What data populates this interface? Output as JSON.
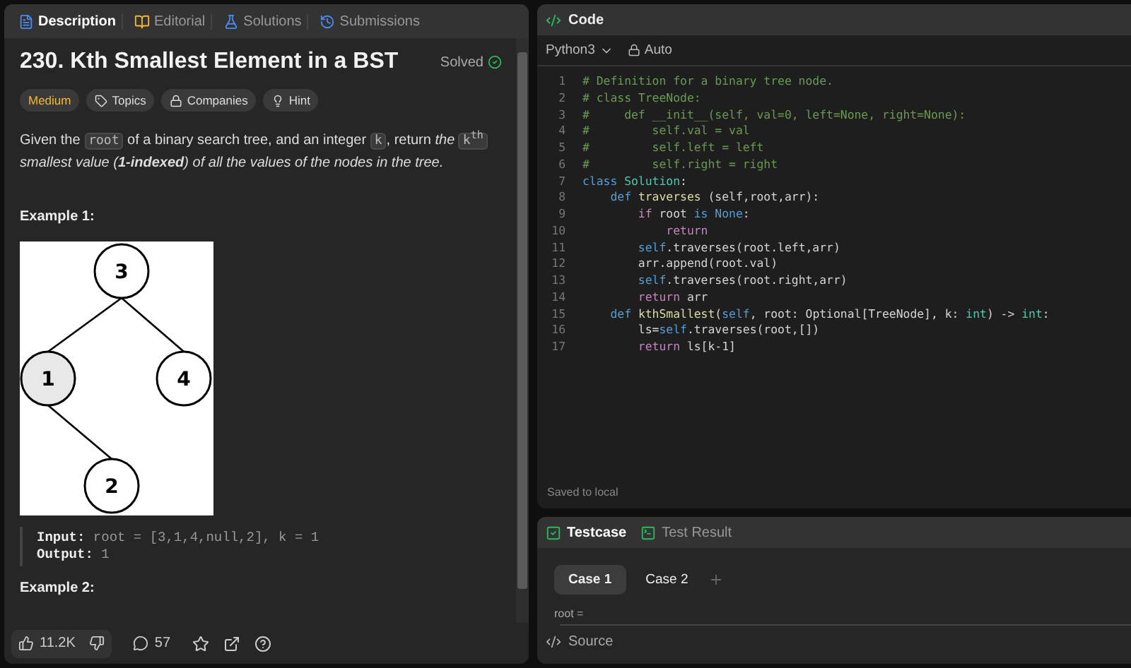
{
  "left_tabs": [
    {
      "label": "Description",
      "selected": true
    },
    {
      "label": "Editorial",
      "selected": false
    },
    {
      "label": "Solutions",
      "selected": false
    },
    {
      "label": "Submissions",
      "selected": false
    }
  ],
  "problem": {
    "title": "230. Kth Smallest Element in a BST",
    "status": "Solved",
    "tags": [
      {
        "label": "Medium",
        "kind": "difficulty"
      },
      {
        "label": "Topics",
        "kind": "topics"
      },
      {
        "label": "Companies",
        "kind": "companies"
      },
      {
        "label": "Hint",
        "kind": "hint"
      }
    ],
    "description": [
      {
        "kind": "plain",
        "text": "Given the "
      },
      {
        "kind": "code",
        "text": "root"
      },
      {
        "kind": "plain",
        "text": " of a binary search tree, and an integer "
      },
      {
        "kind": "code",
        "text": "k"
      },
      {
        "kind": "plain",
        "text": ", return "
      },
      {
        "kind": "italic",
        "text": "the "
      },
      {
        "kind": "code",
        "text": "k$^{th}$"
      },
      {
        "kind": "italic",
        "text": " smallest value (**1-indexed**) of all the values of the nodes in the tree."
      }
    ],
    "examples": [
      {
        "heading": "Example 1:",
        "tree": [
          {
            "value": "3",
            "highlighted": false
          },
          {
            "value": "1",
            "highlighted": true
          },
          {
            "value": "4",
            "highlighted": false
          },
          {
            "value": "2",
            "highlighted": false
          }
        ],
        "lines": [
          {
            "label": "Input:",
            "value": "root = [3,1,4,null,2], k = 1"
          },
          {
            "label": "Output:",
            "value": "1"
          }
        ]
      },
      {
        "heading": "Example 2:"
      }
    ]
  },
  "footer": {
    "likes": "11.2K",
    "comments": "57"
  },
  "code_panel": {
    "title": "Code",
    "language": "Python3",
    "mode": "Auto",
    "status": "Saved to local",
    "lines": [
      {
        "number": "1",
        "tokens": [
          {
            "kind": "comment",
            "text": "# Definition for a binary tree node."
          }
        ]
      },
      {
        "number": "2",
        "tokens": [
          {
            "kind": "comment",
            "text": "# class TreeNode:"
          }
        ]
      },
      {
        "number": "3",
        "tokens": [
          {
            "kind": "comment",
            "text": "#     def __init__(self, val=0, left=None, right=None):"
          }
        ]
      },
      {
        "number": "4",
        "tokens": [
          {
            "kind": "comment",
            "text": "#         self.val = val"
          }
        ]
      },
      {
        "number": "5",
        "tokens": [
          {
            "kind": "comment",
            "text": "#         self.left = left"
          }
        ]
      },
      {
        "number": "6",
        "tokens": [
          {
            "kind": "comment",
            "text": "#         self.right = right"
          }
        ]
      },
      {
        "number": "7",
        "tokens": [
          {
            "kind": "keyword",
            "text": "class "
          },
          {
            "kind": "type",
            "text": "Solution"
          },
          {
            "kind": "plain",
            "text": ":"
          }
        ]
      },
      {
        "number": "8",
        "tokens": [
          {
            "kind": "keyword",
            "text": "    def "
          },
          {
            "kind": "func",
            "text": "traverses"
          },
          {
            "kind": "plain",
            "text": " (self,root,arr):"
          }
        ]
      },
      {
        "number": "9",
        "tokens": [
          {
            "kind": "control",
            "text": "        if"
          },
          {
            "kind": "plain",
            "text": " root "
          },
          {
            "kind": "keyword",
            "text": "is None"
          },
          {
            "kind": "plain",
            "text": ":"
          }
        ]
      },
      {
        "number": "10",
        "tokens": [
          {
            "kind": "control",
            "text": "            return"
          }
        ]
      },
      {
        "number": "11",
        "tokens": [
          {
            "kind": "keyword",
            "text": "        self"
          },
          {
            "kind": "plain",
            "text": ".traverses(root.left,arr)"
          }
        ]
      },
      {
        "number": "12",
        "tokens": [
          {
            "kind": "plain",
            "text": "        arr.append(root.val)"
          }
        ]
      },
      {
        "number": "13",
        "tokens": [
          {
            "kind": "keyword",
            "text": "        self"
          },
          {
            "kind": "plain",
            "text": ".traverses(root.right,arr)"
          }
        ]
      },
      {
        "number": "14",
        "tokens": [
          {
            "kind": "control",
            "text": "        return"
          },
          {
            "kind": "plain",
            "text": " arr"
          }
        ]
      },
      {
        "number": "15",
        "tokens": [
          {
            "kind": "keyword",
            "text": "    def "
          },
          {
            "kind": "func",
            "text": "kthSmallest"
          },
          {
            "kind": "plain",
            "text": "("
          },
          {
            "kind": "keyword",
            "text": "self"
          },
          {
            "kind": "plain",
            "text": ", root: Optional[TreeNode], k: "
          },
          {
            "kind": "type",
            "text": "int"
          },
          {
            "kind": "plain",
            "text": ") -> "
          },
          {
            "kind": "type",
            "text": "int"
          },
          {
            "kind": "plain",
            "text": ":"
          }
        ]
      },
      {
        "number": "16",
        "tokens": [
          {
            "kind": "plain",
            "text": "        ls="
          },
          {
            "kind": "keyword",
            "text": "self"
          },
          {
            "kind": "plain",
            "text": ".traverses(root,[])"
          }
        ]
      },
      {
        "number": "17",
        "tokens": [
          {
            "kind": "control",
            "text": "        return"
          },
          {
            "kind": "plain",
            "text": " ls[k-1]"
          }
        ]
      }
    ]
  },
  "test_panel": {
    "tabs": [
      {
        "label": "Testcase",
        "selected": true
      },
      {
        "label": "Test Result",
        "selected": false
      }
    ],
    "cases": [
      {
        "label": "Case 1",
        "selected": true
      },
      {
        "label": "Case 2",
        "selected": false
      }
    ],
    "field_label": "root =",
    "footer": "Source"
  }
}
